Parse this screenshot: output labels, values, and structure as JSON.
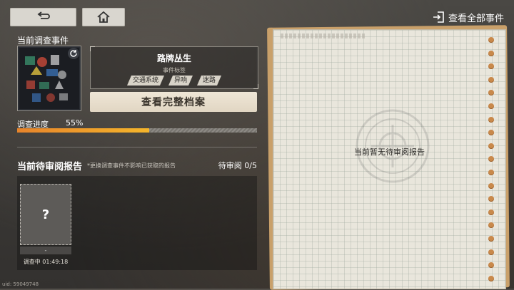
{
  "topbar": {
    "back_icon": "return-icon",
    "home_icon": "home-icon",
    "view_all_label": "查看全部事件",
    "view_all_icon": "enter-icon"
  },
  "current_event": {
    "section_title": "当前调查事件",
    "name": "路牌丛生",
    "tag_header": "事件标签",
    "tags": [
      "交通系统",
      "异响",
      "迷路"
    ],
    "archive_button": "查看完整档案",
    "progress_label": "调查进度",
    "progress_text": "55%",
    "progress_value": 0.55
  },
  "pending": {
    "title": "当前待审阅报告",
    "note": "*更换调查事件不影响已获取的报告",
    "count_text": "待审阅 0/5",
    "slot": {
      "symbol": "?",
      "bar_text": "-",
      "status": "调查中 01:49:18"
    }
  },
  "notebook": {
    "empty_text": "当前暂无待审阅报告"
  },
  "footer": {
    "uid": "uid: 59049748"
  },
  "colors": {
    "progress_start": "#e7842b",
    "progress_end": "#f5b52b",
    "notebook_paper": "#e9e6dc",
    "notebook_ring": "#c9894b"
  }
}
